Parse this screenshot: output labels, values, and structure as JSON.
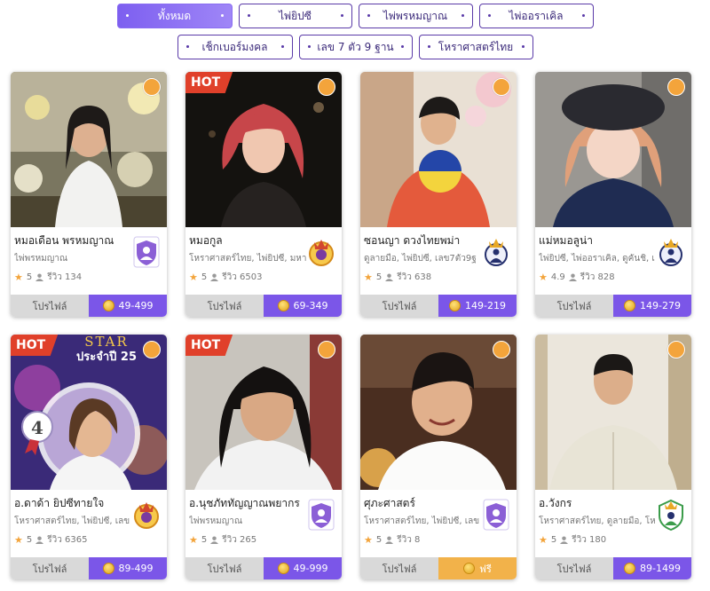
{
  "filters": {
    "row1": [
      "ทั้งหมด",
      "ไพ่ยิปซี",
      "ไพ่พรหมญาณ",
      "ไพ่ออราเคิล"
    ],
    "row2": [
      "เช็กเบอร์มงคล",
      "เลข 7 ตัว 9 ฐาน",
      "โหราศาสตร์ไทย"
    ],
    "active_index": 0
  },
  "cards": [
    {
      "name": "หมอเดือน พรหมญาณ",
      "skills": "ไพ่พรหมญาณ",
      "rating": "5",
      "reviews": "รีวิว 134",
      "profile_label": "โปรไฟล์",
      "price": "49-499",
      "hot": false,
      "badge_icon": "purple-user-shield-icon",
      "photo_icon": "fortune-teller-photo"
    },
    {
      "name": "หมอกูล",
      "skills": "โหราศาสตร์ไทย, ไพ่ยิปซี, มหา",
      "rating": "5",
      "reviews": "รีวิว 6503",
      "profile_label": "โปรไฟล์",
      "price": "69-349",
      "hot": true,
      "hot_label": "HOT",
      "badge_icon": "gold-crown-badge-icon",
      "photo_icon": "fortune-teller-photo"
    },
    {
      "name": "ซอนญา ดวงไทยพม่า",
      "skills": "ดูลายมือ, ไพ่ยิปซี, เลข7ตัว9ฐ",
      "rating": "5",
      "reviews": "รีวิว 638",
      "profile_label": "โปรไฟล์",
      "price": "149-219",
      "hot": false,
      "badge_icon": "navy-crown-badge-icon",
      "photo_icon": "fortune-teller-photo"
    },
    {
      "name": "แม่หมอลูน่า",
      "skills": "ไพ่ยิปซี, ไพ่ออราเคิล, ดูคันชิ, เ",
      "rating": "4.9",
      "reviews": "รีวิว 828",
      "profile_label": "โปรไฟล์",
      "price": "149-279",
      "hot": false,
      "badge_icon": "navy-crown-badge-icon",
      "photo_icon": "fortune-teller-photo"
    },
    {
      "name": "อ.ดาด้า ยิปซีทายใจ",
      "skills": "โหราศาสตร์ไทย, ไพ่ยิปซี, เลข",
      "rating": "5",
      "reviews": "รีวิว 6365",
      "profile_label": "โปรไฟล์",
      "price": "89-499",
      "hot": true,
      "hot_label": "HOT",
      "badge_icon": "gold-crown-badge-icon",
      "photo_icon": "fortune-teller-photo",
      "banner_text": "STAR",
      "banner_sub": "ประจำปี 25",
      "rank": "4"
    },
    {
      "name": "อ.นุชภัททัญญาณพยากร",
      "skills": "ไพ่พรหมญาณ",
      "rating": "5",
      "reviews": "รีวิว 265",
      "profile_label": "โปรไฟล์",
      "price": "49-999",
      "hot": true,
      "hot_label": "HOT",
      "badge_icon": "purple-user-shield-icon",
      "photo_icon": "fortune-teller-photo"
    },
    {
      "name": "ศุภะศาสตร์",
      "skills": "โหราศาสตร์ไทย, ไพ่ยิปซี, เลข",
      "rating": "5",
      "reviews": "รีวิว 8",
      "profile_label": "โปรไฟล์",
      "price": "ฟรี",
      "free": true,
      "hot": false,
      "badge_icon": "purple-user-shield-icon",
      "photo_icon": "fortune-teller-photo"
    },
    {
      "name": "อ.วังกร",
      "skills": "โหราศาสตร์ไทย, ดูลายมือ, โห",
      "rating": "5",
      "reviews": "รีวิว 180",
      "profile_label": "โปรไฟล์",
      "price": "89-1499",
      "hot": false,
      "badge_icon": "green-user-shield-icon",
      "photo_icon": "fortune-teller-photo"
    }
  ],
  "colors": {
    "accent": "#7b56e8",
    "chip_border": "#5a3aa8",
    "hot": "#e0402a",
    "status": "#f3a43b",
    "free": "#f2b24a"
  }
}
